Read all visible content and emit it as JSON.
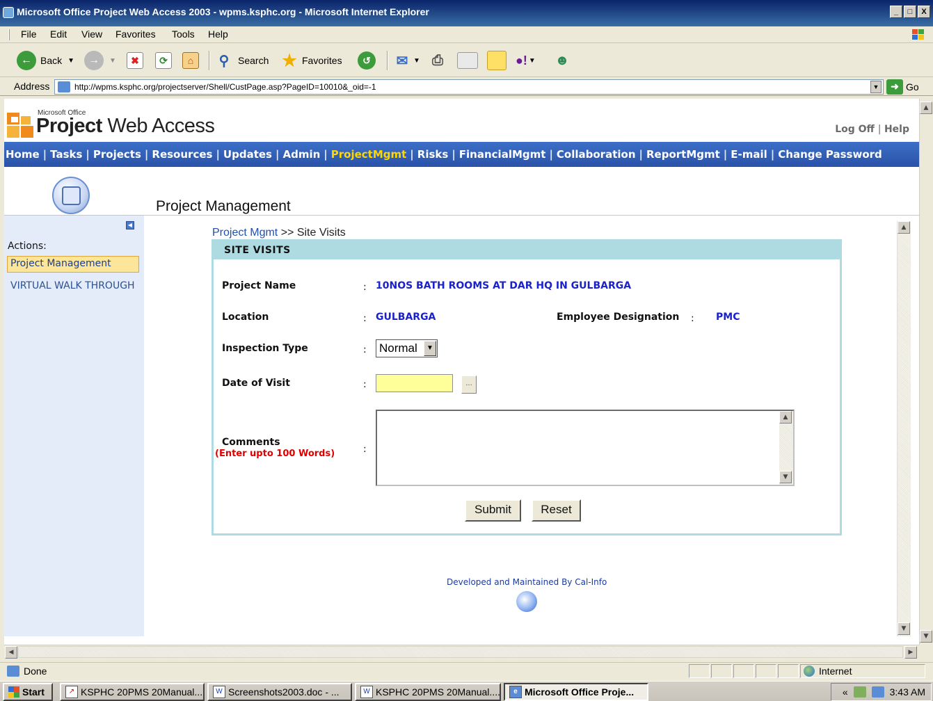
{
  "window": {
    "title": "Microsoft Office Project Web Access 2003 - wpms.ksphc.org - Microsoft Internet Explorer",
    "buttons": {
      "minimize": "_",
      "maximize": "□",
      "close": "X"
    }
  },
  "menu": [
    "File",
    "Edit",
    "View",
    "Favorites",
    "Tools",
    "Help"
  ],
  "toolbar": {
    "back_label": "Back",
    "search_label": "Search",
    "favorites_label": "Favorites"
  },
  "address": {
    "label": "Address",
    "url": "http://wpms.ksphc.org/projectserver/Shell/CustPage.asp?PageID=10010&_oid=-1",
    "go_label": "Go"
  },
  "pwa": {
    "logo_small": "Microsoft Office",
    "logo_bold": "Project",
    "logo_rest": " Web Access",
    "logoff": "Log Off",
    "help": "Help",
    "nav": [
      "Home",
      "Tasks",
      "Projects",
      "Resources",
      "Updates",
      "Admin",
      "ProjectMgmt",
      "Risks",
      "FinancialMgmt",
      "Collaboration",
      "ReportMgmt",
      "E-mail",
      "Change Password"
    ],
    "active_nav": "ProjectMgmt",
    "page_title": "Project Management"
  },
  "sidebar": {
    "actions_label": "Actions:",
    "items": [
      "Project Management",
      "VIRTUAL WALK THROUGH"
    ]
  },
  "breadcrumb": {
    "link": "Project Mgmt",
    "separator": " >> ",
    "current": "Site Visits"
  },
  "form": {
    "header": "SITE VISITS",
    "project_name_label": "Project Name",
    "project_name_value": "10NOS BATH ROOMS AT DAR HQ IN GULBARGA",
    "location_label": "Location",
    "location_value": "GULBARGA",
    "designation_label": "Employee Designation",
    "designation_value": "PMC",
    "inspection_type_label": "Inspection Type",
    "inspection_type_value": "Normal",
    "date_label": "Date of Visit",
    "date_value": "",
    "date_button": "...",
    "comments_label": "Comments",
    "comments_note": "(Enter upto 100 Words)",
    "comments_value": "",
    "colon": ":",
    "submit_label": "Submit",
    "reset_label": "Reset"
  },
  "footer": {
    "text": "Developed and Maintained By Cal-Info"
  },
  "status": {
    "text": "Done",
    "zone": "Internet"
  },
  "taskbar": {
    "start": "Start",
    "tasks": [
      "KSPHC 20PMS 20Manual....",
      "Screenshots2003.doc - ...",
      "KSPHC 20PMS 20Manual....",
      "Microsoft Office Proje..."
    ],
    "tray_chevron": "«",
    "clock": "3:43 AM"
  },
  "colors": {
    "nav_bg": "#2a52a8",
    "nav_active": "#ffd700",
    "form_header_bg": "#aedbe2",
    "value_text": "#1a22cc",
    "note_text": "#e00000",
    "date_input_bg": "#ffff99"
  }
}
